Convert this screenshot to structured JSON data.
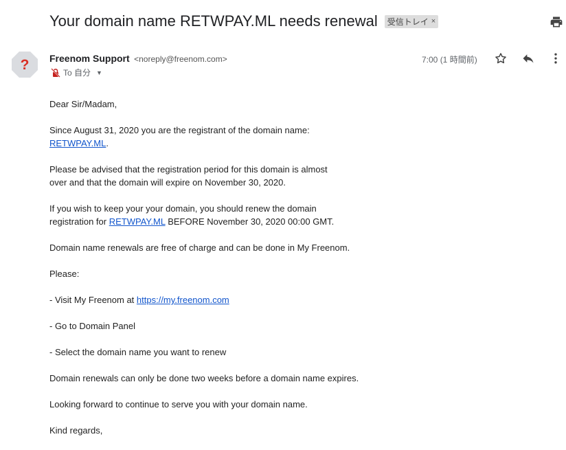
{
  "header": {
    "subject": "Your domain name RETWPAY.ML needs renewal",
    "label": "受信トレイ",
    "label_close": "×"
  },
  "sender": {
    "avatar_glyph": "?",
    "name": "Freenom Support",
    "email": "<noreply@freenom.com>",
    "to": "To 自分",
    "time": "7:00 (1 時間前)"
  },
  "body": {
    "greeting": "Dear Sir/Madam,",
    "p1_text": "Since August 31, 2020 you are the registrant of the domain name:",
    "p1_link": "RETWPAY.ML",
    "p1_end": ".",
    "p2_line1": "Please be advised that the registration period for this domain is almost",
    "p2_line2": "over and that the domain will expire on November 30, 2020.",
    "p3_line1": "If you wish to keep your your domain, you should renew the domain",
    "p3_pre": "registration for ",
    "p3_link": "RETWPAY.ML",
    "p3_post": " BEFORE November 30, 2020 00:00 GMT.",
    "p4": "Domain name renewals are free of charge and can be done in My Freenom.",
    "p5": "Please:",
    "p6_pre": "- Visit My Freenom at ",
    "p6_link": "https://my.freenom.com",
    "p7": "- Go to Domain Panel",
    "p8": "- Select the domain name you want to renew",
    "p9": "Domain renewals can only be done two weeks before a domain name expires.",
    "p10": "Looking forward to continue to serve you with your domain name.",
    "p11": "Kind regards,"
  },
  "icons": {
    "print": "print-icon",
    "star": "star-icon",
    "reply": "reply-icon",
    "more": "more-vert-icon",
    "avatar": "unknown-sender-icon",
    "to_warning": "not-encrypted-icon",
    "dropdown": "chevron-down-icon"
  },
  "colors": {
    "link": "#1155cc",
    "avatar_bg": "#dadce0",
    "avatar_glyph": "#d93025",
    "chip_bg": "#dddddd"
  }
}
